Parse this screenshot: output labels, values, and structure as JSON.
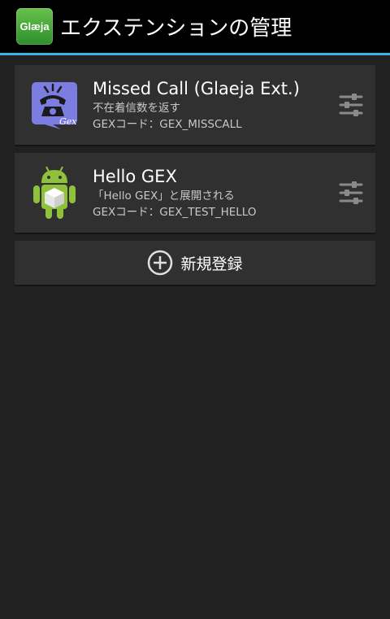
{
  "actionbar": {
    "app_icon_text": "Glæja",
    "title": "エクステンションの管理",
    "accent_color": "#33b5e5"
  },
  "extensions": [
    {
      "icon": "missed-call-gex-icon",
      "icon_text": "Gex",
      "title": "Missed Call (Glaeja Ext.)",
      "description": "不在着信数を返す",
      "code": "GEXコード：GEX_MISSCALL"
    },
    {
      "icon": "android-robot-icon",
      "title": "Hello GEX",
      "description": "「Hello GEX」と展開される",
      "code": "GEXコード：GEX_TEST_HELLO"
    }
  ],
  "add_button": {
    "icon": "add-circle-icon",
    "label": "新規登録"
  }
}
